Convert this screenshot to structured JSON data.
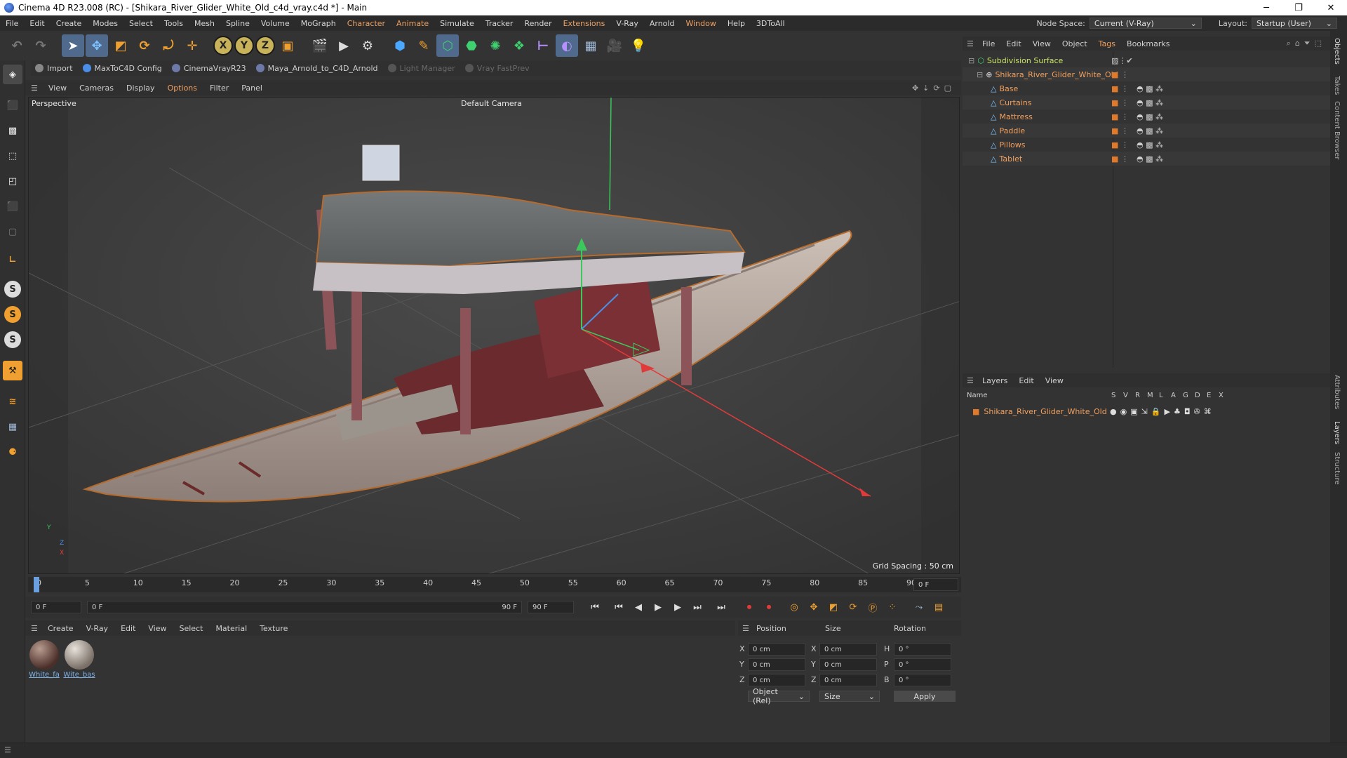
{
  "window": {
    "title": "Cinema 4D R23.008 (RC) - [Shikara_River_Glider_White_Old_c4d_vray.c4d *] - Main",
    "controls": [
      "─",
      "❐",
      "✕"
    ]
  },
  "menubar": {
    "items": [
      "File",
      "Edit",
      "Create",
      "Modes",
      "Select",
      "Tools",
      "Mesh",
      "Spline",
      "Volume",
      "MoGraph",
      "Character",
      "Animate",
      "Simulate",
      "Tracker",
      "Render",
      "Extensions",
      "V-Ray",
      "Arnold",
      "Window",
      "Help",
      "3DToAll"
    ],
    "node_space_label": "Node Space:",
    "node_space_value": "Current (V-Ray)",
    "layout_label": "Layout:",
    "layout_value": "Startup (User)"
  },
  "pluginbar": {
    "items": [
      {
        "label": "Import",
        "enabled": true
      },
      {
        "label": "MaxToC4D Config",
        "enabled": true
      },
      {
        "label": "CinemaVrayR23",
        "enabled": true
      },
      {
        "label": "Maya_Arnold_to_C4D_Arnold",
        "enabled": true
      },
      {
        "label": "Light Manager",
        "enabled": false
      },
      {
        "label": "Vray FastPrev",
        "enabled": false
      }
    ]
  },
  "toolbar": {
    "axis_x": "X",
    "axis_y": "Y",
    "axis_z": "Z"
  },
  "left_tools": {
    "s1": "S",
    "s2": "S",
    "s3": "S"
  },
  "viewport": {
    "menu": [
      "View",
      "Cameras",
      "Display",
      "Options",
      "Filter",
      "Panel"
    ],
    "view_name": "Perspective",
    "camera": "Default Camera",
    "grid_spacing": "Grid Spacing : 50 cm",
    "axis_labels": {
      "y": "Y",
      "z": "Z",
      "x": "X"
    }
  },
  "timeline": {
    "ticks": [
      "0",
      "5",
      "10",
      "15",
      "20",
      "25",
      "30",
      "35",
      "40",
      "45",
      "50",
      "55",
      "60",
      "65",
      "70",
      "75",
      "80",
      "85",
      "90"
    ],
    "current_frame_field": "0 F",
    "start_field": "0 F",
    "range_start": "0 F",
    "range_end": "90 F",
    "end_field": "90 F",
    "current": 0,
    "max": 90
  },
  "material_manager": {
    "menu": [
      "Create",
      "V-Ray",
      "Edit",
      "View",
      "Select",
      "Material",
      "Texture"
    ],
    "materials": [
      {
        "name": "White_fa"
      },
      {
        "name": "Wite_bas"
      }
    ]
  },
  "coordinates": {
    "headers": {
      "position": "Position",
      "size": "Size",
      "rotation": "Rotation"
    },
    "rows": [
      {
        "axis": "X",
        "pos": "0 cm",
        "size_axis": "X",
        "size": "0 cm",
        "rot_axis": "H",
        "rot": "0 °"
      },
      {
        "axis": "Y",
        "pos": "0 cm",
        "size_axis": "Y",
        "size": "0 cm",
        "rot_axis": "P",
        "rot": "0 °"
      },
      {
        "axis": "Z",
        "pos": "0 cm",
        "size_axis": "Z",
        "size": "0 cm",
        "rot_axis": "B",
        "rot": "0 °"
      }
    ],
    "mode": "Object (Rel)",
    "size_mode": "Size",
    "apply": "Apply"
  },
  "object_manager": {
    "menu": [
      "File",
      "Edit",
      "View",
      "Object",
      "Tags",
      "Bookmarks"
    ],
    "objects": [
      {
        "name": "Subdivision Surface",
        "level": 0,
        "color": "green"
      },
      {
        "name": "Shikara_River_Glider_White_Old",
        "level": 1,
        "color": "orange"
      },
      {
        "name": "Base",
        "level": 2,
        "color": "orange"
      },
      {
        "name": "Curtains",
        "level": 2,
        "color": "orange"
      },
      {
        "name": "Mattress",
        "level": 2,
        "color": "orange"
      },
      {
        "name": "Paddle",
        "level": 2,
        "color": "orange"
      },
      {
        "name": "Pillows",
        "level": 2,
        "color": "orange"
      },
      {
        "name": "Tablet",
        "level": 2,
        "color": "orange"
      }
    ]
  },
  "layer_manager": {
    "menu": [
      "Layers",
      "Edit",
      "View"
    ],
    "columns": [
      "Name",
      "S",
      "V",
      "R",
      "M",
      "L",
      "A",
      "G",
      "D",
      "E",
      "X"
    ],
    "layers": [
      {
        "name": "Shikara_River_Glider_White_Old",
        "color": "#e07a2a"
      }
    ]
  },
  "right_tabs": [
    "Objects",
    "Takes",
    "Content Browser",
    "Attributes",
    "Layers",
    "Structure"
  ],
  "colors": {
    "accent_orange": "#f0a060",
    "selection_blue": "#4f6a8c",
    "bg_dark": "#333333",
    "green_label": "#c9e36a"
  }
}
